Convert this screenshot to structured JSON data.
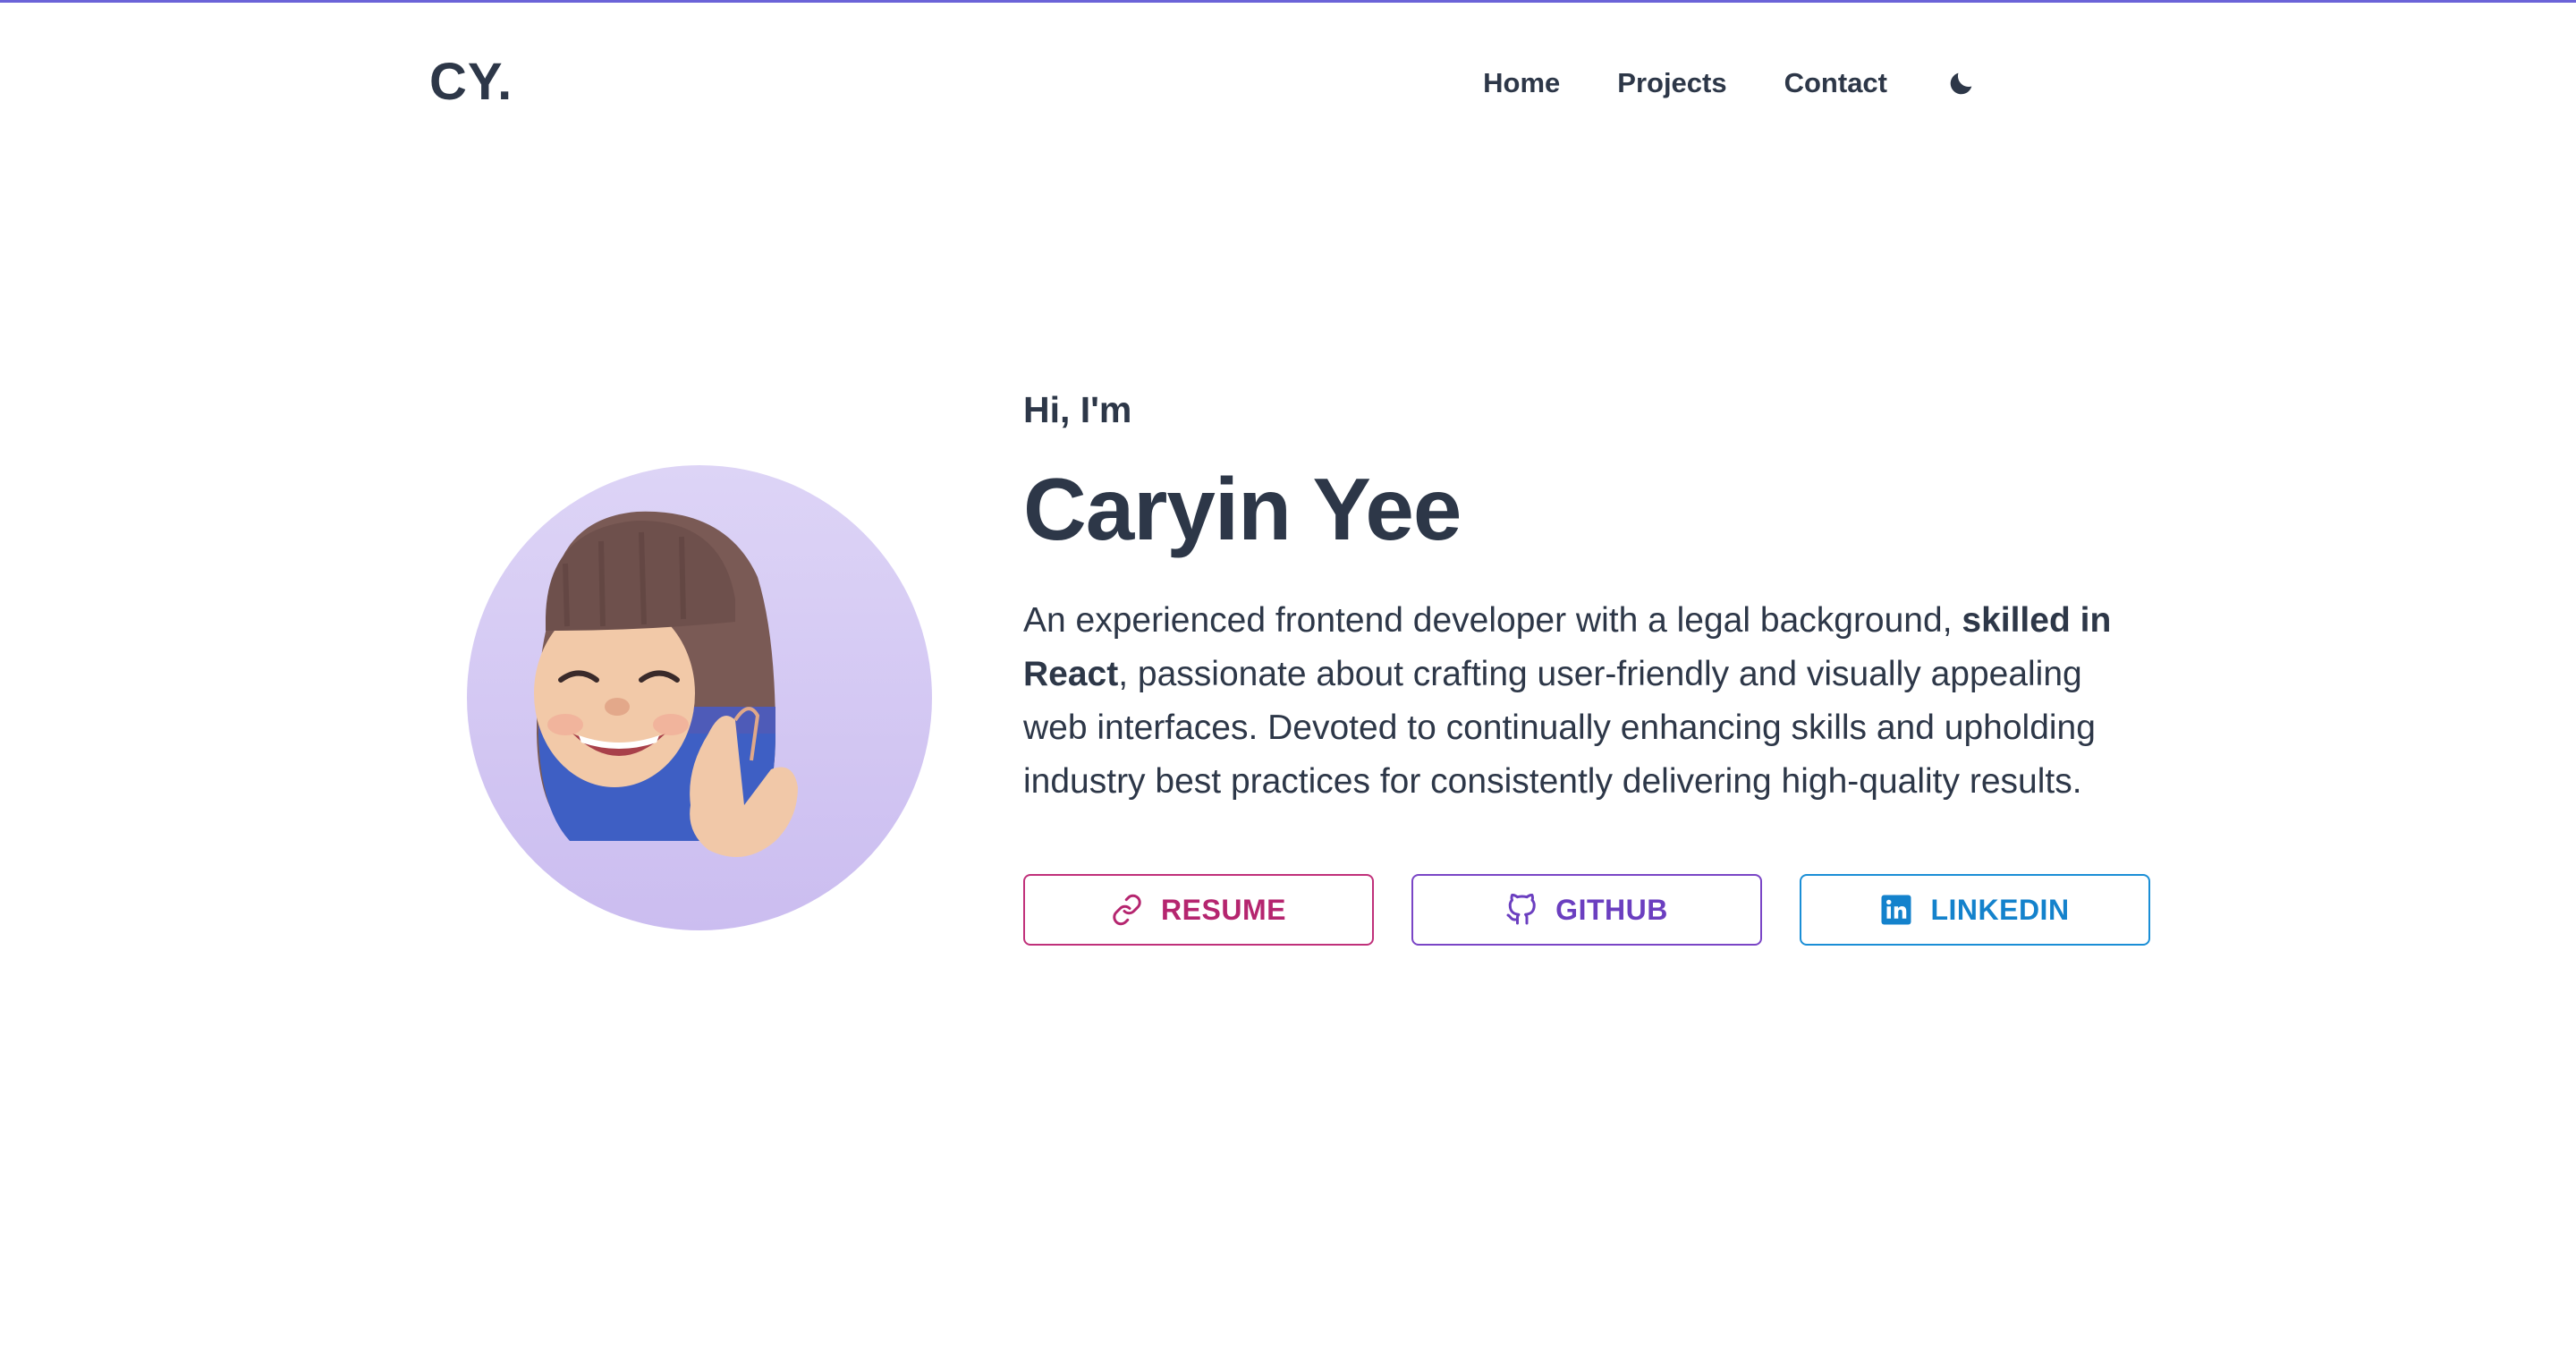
{
  "nav": {
    "logo": "CY.",
    "links": [
      "Home",
      "Projects",
      "Contact"
    ],
    "theme_icon": "moon-icon"
  },
  "hero": {
    "greeting": "Hi, I'm",
    "name": "Caryin Yee",
    "bio_part1": "An experienced frontend developer with a legal background, ",
    "bio_bold": "skilled in React",
    "bio_part2": ", passionate about crafting user-friendly and visually appealing web interfaces. Devoted to continually enhancing skills and upholding industry best practices for consistently delivering high-quality results.",
    "avatar_icon": "memoji-avatar"
  },
  "buttons": {
    "resume": {
      "label": "RESUME",
      "icon": "link-icon",
      "color": "#b5256f"
    },
    "github": {
      "label": "GITHUB",
      "icon": "github-icon",
      "color": "#6b3fc0"
    },
    "linkedin": {
      "label": "LINKEDIN",
      "icon": "linkedin-icon",
      "color": "#1482cc"
    }
  },
  "colors": {
    "text": "#2d3748",
    "accent_bar": "#6b63d8",
    "avatar_bg": "#d4c8f3"
  }
}
